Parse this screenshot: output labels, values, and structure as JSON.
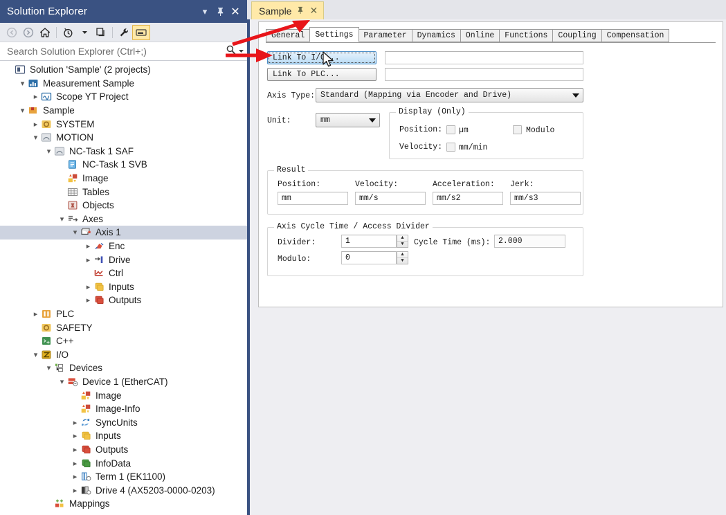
{
  "solution_explorer": {
    "title": "Solution Explorer",
    "title_buttons": [
      {
        "name": "dropdown",
        "glyph": "▾"
      },
      {
        "name": "pin",
        "glyph": "☩"
      },
      {
        "name": "close",
        "glyph": "✕"
      }
    ],
    "toolbar": [
      {
        "name": "back-icon",
        "label": "Back",
        "enabled": false
      },
      {
        "name": "forward-icon",
        "label": "Forward",
        "enabled": false
      },
      {
        "name": "home-icon",
        "label": "Home",
        "enabled": true
      },
      {
        "name": "pending-changes-icon",
        "label": "Pending Changes",
        "enabled": true
      },
      {
        "name": "chevron-down-icon",
        "label": "More",
        "enabled": true
      },
      {
        "name": "copy-icon",
        "label": "Show All Files",
        "enabled": true
      },
      {
        "name": "properties-wrench-icon",
        "label": "Properties",
        "enabled": true
      },
      {
        "name": "preview-selected-items-icon",
        "label": "Preview Selected Items",
        "enabled": true
      }
    ],
    "search": {
      "placeholder": "Search Solution Explorer (Ctrl+;)",
      "value": "",
      "icon": "search-icon",
      "dropdown_glyph": "▾"
    },
    "tree": [
      {
        "depth": 0,
        "arrow": "none",
        "icon": "solution-icon",
        "label": "Solution 'Sample' (2 projects)",
        "selected": false
      },
      {
        "depth": 1,
        "arrow": "expanded",
        "icon": "measurement-icon",
        "label": "Measurement Sample",
        "selected": false
      },
      {
        "depth": 2,
        "arrow": "collapsed",
        "icon": "scope-icon",
        "label": "Scope YT Project",
        "selected": false
      },
      {
        "depth": 1,
        "arrow": "expanded",
        "icon": "project-icon",
        "label": "Sample",
        "selected": false
      },
      {
        "depth": 2,
        "arrow": "collapsed",
        "icon": "system-icon",
        "label": "SYSTEM",
        "selected": false
      },
      {
        "depth": 2,
        "arrow": "expanded",
        "icon": "motion-icon",
        "label": "MOTION",
        "selected": false
      },
      {
        "depth": 3,
        "arrow": "expanded",
        "icon": "nctask-saf-icon",
        "label": "NC-Task 1 SAF",
        "selected": false
      },
      {
        "depth": 4,
        "arrow": "none",
        "icon": "nctask-svb-icon",
        "label": "NC-Task 1 SVB",
        "selected": false
      },
      {
        "depth": 4,
        "arrow": "none",
        "icon": "image-icon",
        "label": "Image",
        "selected": false
      },
      {
        "depth": 4,
        "arrow": "none",
        "icon": "tables-icon",
        "label": "Tables",
        "selected": false
      },
      {
        "depth": 4,
        "arrow": "none",
        "icon": "objects-icon",
        "label": "Objects",
        "selected": false
      },
      {
        "depth": 4,
        "arrow": "expanded",
        "icon": "axes-icon",
        "label": "Axes",
        "selected": false
      },
      {
        "depth": 5,
        "arrow": "expanded",
        "icon": "axis-icon",
        "label": "Axis 1",
        "selected": true
      },
      {
        "depth": 6,
        "arrow": "collapsed",
        "icon": "enc-icon",
        "label": "Enc",
        "selected": false
      },
      {
        "depth": 6,
        "arrow": "collapsed",
        "icon": "drive-icon",
        "label": "Drive",
        "selected": false
      },
      {
        "depth": 6,
        "arrow": "none",
        "icon": "ctrl-icon",
        "label": "Ctrl",
        "selected": false
      },
      {
        "depth": 6,
        "arrow": "collapsed",
        "icon": "inputs-icon",
        "label": "Inputs",
        "selected": false
      },
      {
        "depth": 6,
        "arrow": "collapsed",
        "icon": "outputs-icon",
        "label": "Outputs",
        "selected": false
      },
      {
        "depth": 2,
        "arrow": "collapsed",
        "icon": "plc-icon",
        "label": "PLC",
        "selected": false
      },
      {
        "depth": 2,
        "arrow": "none",
        "icon": "safety-icon",
        "label": "SAFETY",
        "selected": false
      },
      {
        "depth": 2,
        "arrow": "none",
        "icon": "cpp-icon",
        "label": "C++",
        "selected": false
      },
      {
        "depth": 2,
        "arrow": "expanded",
        "icon": "io-icon",
        "label": "I/O",
        "selected": false
      },
      {
        "depth": 3,
        "arrow": "expanded",
        "icon": "devices-icon",
        "label": "Devices",
        "selected": false
      },
      {
        "depth": 4,
        "arrow": "expanded",
        "icon": "device-ethercat-icon",
        "label": "Device 1 (EtherCAT)",
        "selected": false
      },
      {
        "depth": 5,
        "arrow": "none",
        "icon": "image-icon",
        "label": "Image",
        "selected": false
      },
      {
        "depth": 5,
        "arrow": "none",
        "icon": "image-icon",
        "label": "Image-Info",
        "selected": false
      },
      {
        "depth": 5,
        "arrow": "collapsed",
        "icon": "syncunits-icon",
        "label": "SyncUnits",
        "selected": false
      },
      {
        "depth": 5,
        "arrow": "collapsed",
        "icon": "inputs-link-icon",
        "label": "Inputs",
        "selected": false
      },
      {
        "depth": 5,
        "arrow": "collapsed",
        "icon": "outputs-link-icon",
        "label": "Outputs",
        "selected": false
      },
      {
        "depth": 5,
        "arrow": "collapsed",
        "icon": "infodata-icon",
        "label": "InfoData",
        "selected": false
      },
      {
        "depth": 5,
        "arrow": "collapsed",
        "icon": "term-icon",
        "label": "Term 1 (EK1100)",
        "selected": false
      },
      {
        "depth": 5,
        "arrow": "collapsed",
        "icon": "drive-box-icon",
        "label": "Drive 4 (AX5203-0000-0203)",
        "selected": false
      },
      {
        "depth": 3,
        "arrow": "none",
        "icon": "mappings-icon",
        "label": "Mappings",
        "selected": false
      }
    ]
  },
  "document": {
    "tab": {
      "label": "Sample",
      "pin_glyph": "☩",
      "close_glyph": "✕"
    },
    "form_tabs": [
      {
        "label": "General",
        "active": false
      },
      {
        "label": "Settings",
        "active": true
      },
      {
        "label": "Parameter",
        "active": false
      },
      {
        "label": "Dynamics",
        "active": false
      },
      {
        "label": "Online",
        "active": false
      },
      {
        "label": "Functions",
        "active": false
      },
      {
        "label": "Coupling",
        "active": false
      },
      {
        "label": "Compensation",
        "active": false
      }
    ],
    "settings": {
      "link_to_io_button": "Link To I/O...",
      "link_to_io_value": "",
      "link_to_plc_button": "Link To PLC...",
      "link_to_plc_value": "",
      "axis_type_label": "Axis Type:",
      "axis_type_value": "Standard (Mapping via Encoder and Drive)",
      "unit_label": "Unit:",
      "unit_value": "mm",
      "display_group": {
        "title": "Display (Only)",
        "position_label": "Position:",
        "position_check_label": "µm",
        "position_checked": false,
        "modulo_label": "Modulo",
        "modulo_checked": false,
        "velocity_label": "Velocity:",
        "velocity_check_label": "mm/min",
        "velocity_checked": false
      },
      "result_group": {
        "title": "Result",
        "fields": [
          {
            "label": "Position:",
            "value": "mm"
          },
          {
            "label": "Velocity:",
            "value": "mm/s"
          },
          {
            "label": "Acceleration:",
            "value": "mm/s2"
          },
          {
            "label": "Jerk:",
            "value": "mm/s3"
          }
        ]
      },
      "cycle_group": {
        "title": "Axis Cycle Time / Access Divider",
        "divider_label": "Divider:",
        "divider_value": "1",
        "modulo_label": "Modulo:",
        "modulo_value": "0",
        "cycle_time_label": "Cycle Time (ms):",
        "cycle_time_value": "2.000"
      }
    }
  },
  "annotations": {
    "arrow_color": "#e8151a",
    "arrows": [
      {
        "name": "arrow-to-general-tab",
        "target": "General tab"
      },
      {
        "name": "arrow-to-link-to-io",
        "target": "Link To I/O... button"
      }
    ]
  },
  "colors": {
    "panel_title_bg": "#3a5282",
    "doc_tab_bg": "#ffe9a8",
    "selection_bg": "#cdd3e0",
    "toolbar_bg": "#e8eaef",
    "workspace_bg": "#eeeef2",
    "focus_button": "#b9dcf5"
  }
}
